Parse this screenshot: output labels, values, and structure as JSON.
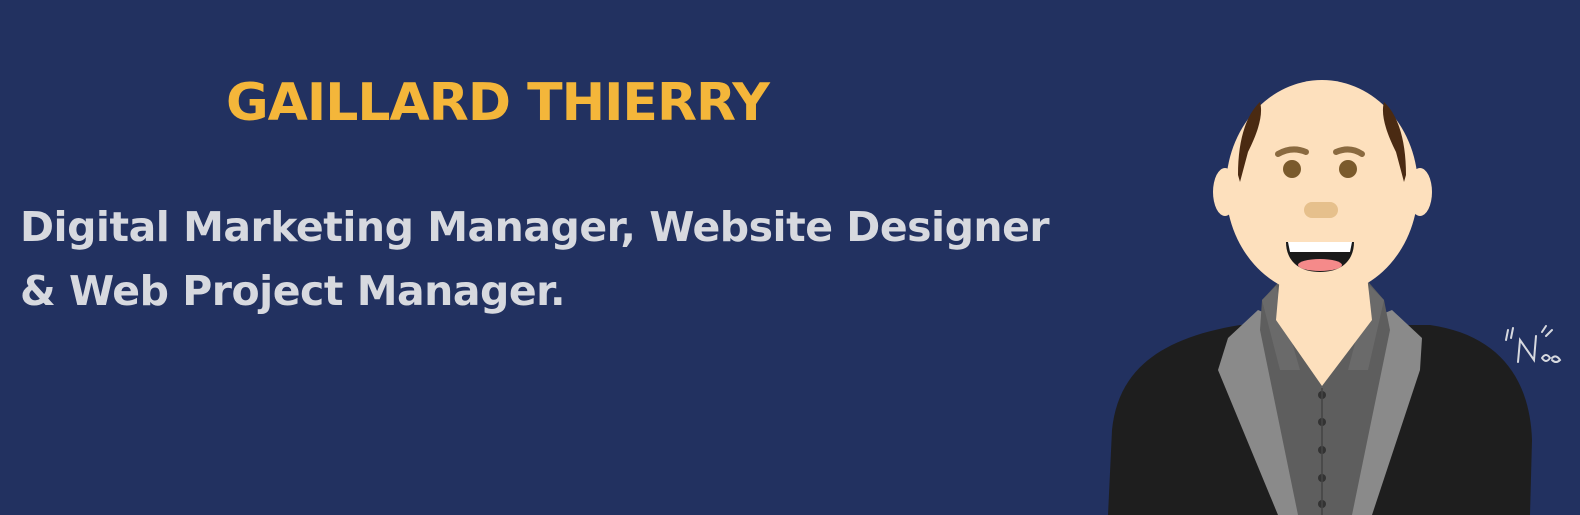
{
  "header": {
    "name": "GAILLARD THIERRY"
  },
  "tagline": {
    "line1": "Digital Marketing Manager, Website Designer",
    "line2": "& Web Project Manager."
  },
  "illustration": {
    "icon": "cartoon-avatar-icon",
    "signature_icon": "signature-icon"
  },
  "colors": {
    "background": "#223160",
    "name": "#f4b63a",
    "tagline": "#d7d9df",
    "skin": "#fde0bd",
    "hair": "#4a2a12",
    "jacket": "#1e1e1e",
    "lapel": "#8a8a8a",
    "shirt": "#5e5e5e"
  }
}
